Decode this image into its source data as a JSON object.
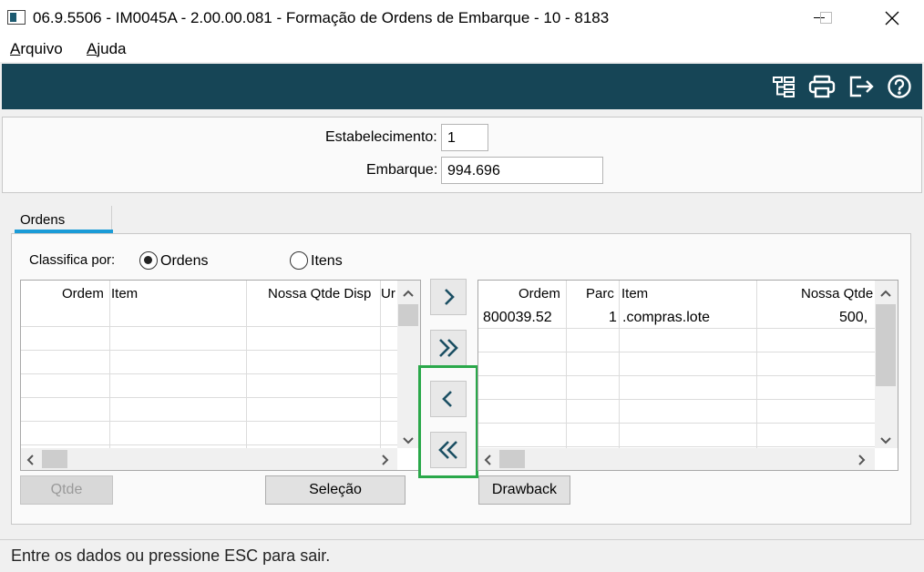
{
  "window": {
    "title": "06.9.5506 - IM0045A - 2.00.00.081 - Formação de Ordens de Embarque - 10 - 8183",
    "minimize": "—",
    "maximize": "☐",
    "close": "✕"
  },
  "menu": {
    "arquivo_first": "A",
    "arquivo_rest": "rquivo",
    "ajuda_first": "A",
    "ajuda_rest": "juda"
  },
  "toolbar": {
    "icons": [
      "tree-structure-icon",
      "printer-icon",
      "exit-icon",
      "help-icon"
    ]
  },
  "header": {
    "estabelecimento_label": "Estabelecimento:",
    "estabelecimento_value": "1",
    "embarque_label": "Embarque:",
    "embarque_value": "994.696"
  },
  "tabs": [
    {
      "label": "Ordens",
      "active": true
    }
  ],
  "sort": {
    "label": "Classifica por:",
    "option_ordens": "Ordens",
    "option_itens": "Itens",
    "selected": "Ordens"
  },
  "left_grid": {
    "columns": [
      "Ordem",
      "Item",
      "Nossa Qtde Disp",
      "Ur"
    ]
  },
  "right_grid": {
    "columns": [
      "Ordem",
      "Parc",
      "Item",
      "Nossa Qtde"
    ],
    "rows": [
      {
        "ordem": "800039.52",
        "parc": "1",
        "item": ".compras.lote",
        "nossa_qtde": "500,"
      }
    ]
  },
  "move_buttons": {
    "add_one": "›",
    "add_all": "»",
    "remove_one": "‹",
    "remove_all": "«"
  },
  "buttons": {
    "qtde": "Qtde",
    "selecao": "Seleção",
    "drawback": "Drawback"
  },
  "status": {
    "text": "Entre os dados ou pressione ESC para sair."
  },
  "colors": {
    "toolbar_bg": "#164556",
    "tab_accent": "#1a9bd7",
    "highlight": "#2aa84a"
  }
}
